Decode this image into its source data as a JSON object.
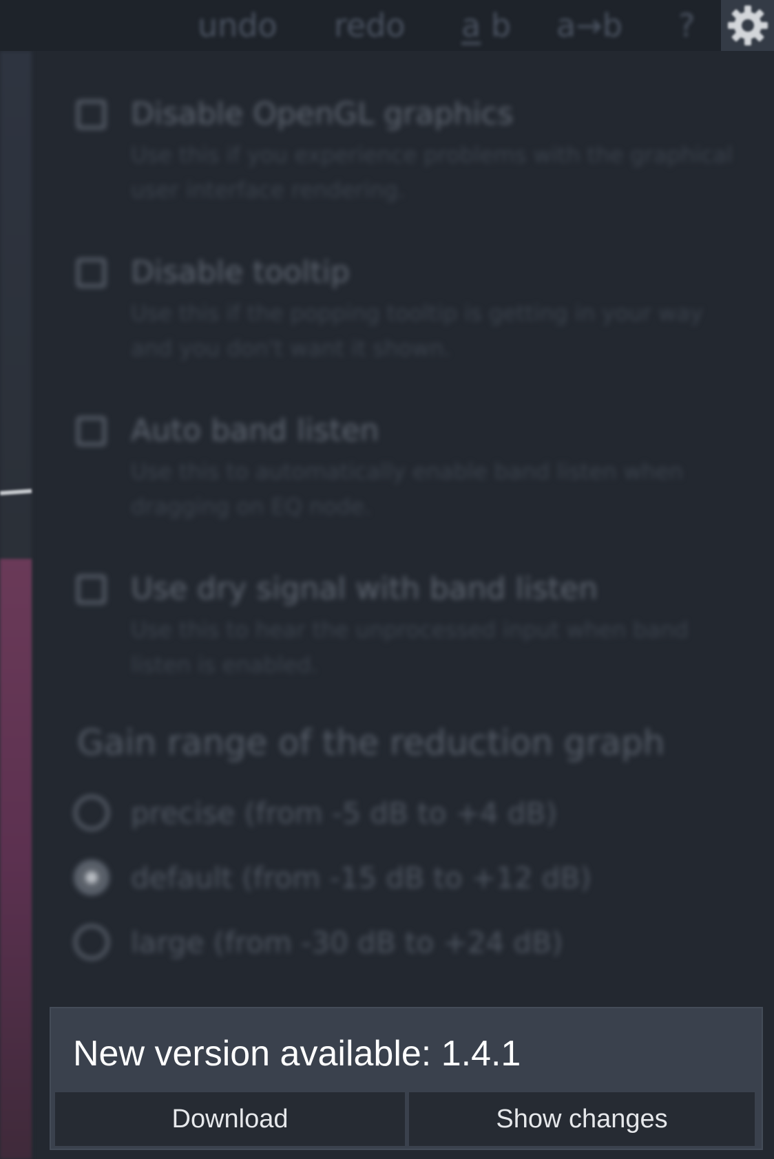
{
  "toolbar": {
    "undo_label": "undo",
    "redo_label": "redo",
    "ab_a_label": "a",
    "ab_b_label": " b",
    "copy_ab_label": "a→b",
    "help_label": "?",
    "settings_icon": "gear-icon"
  },
  "settings": {
    "options": [
      {
        "title": "Disable OpenGL graphics",
        "description": "Use this if you experience problems with the graphical user interface rendering.",
        "checked": false
      },
      {
        "title": "Disable tooltip",
        "description": "Use this if the popping tooltip is getting in your way and you don't want it shown.",
        "checked": false
      },
      {
        "title": "Auto band listen",
        "description": "Use this to automatically enable band listen when dragging on EQ node.",
        "checked": false
      },
      {
        "title": "Use dry signal with band listen",
        "description": "Use this to hear the unprocessed input when band listen is enabled.",
        "checked": false
      }
    ],
    "gain_range": {
      "title": "Gain range of the reduction graph",
      "choices": [
        {
          "label": "precise (from -5 dB to +4 dB)",
          "selected": false
        },
        {
          "label": "default (from -15 dB to +12 dB)",
          "selected": true
        },
        {
          "label": "large (from -30 dB to +24 dB)",
          "selected": false
        }
      ]
    }
  },
  "update": {
    "title": "New version available: 1.4.1",
    "download_label": "Download",
    "show_changes_label": "Show changes"
  },
  "colors": {
    "background": "#232830",
    "toolbar": "#1e232a",
    "panel": "#3a414d",
    "button": "#262b33",
    "accent_bar": "#6a3a58"
  }
}
